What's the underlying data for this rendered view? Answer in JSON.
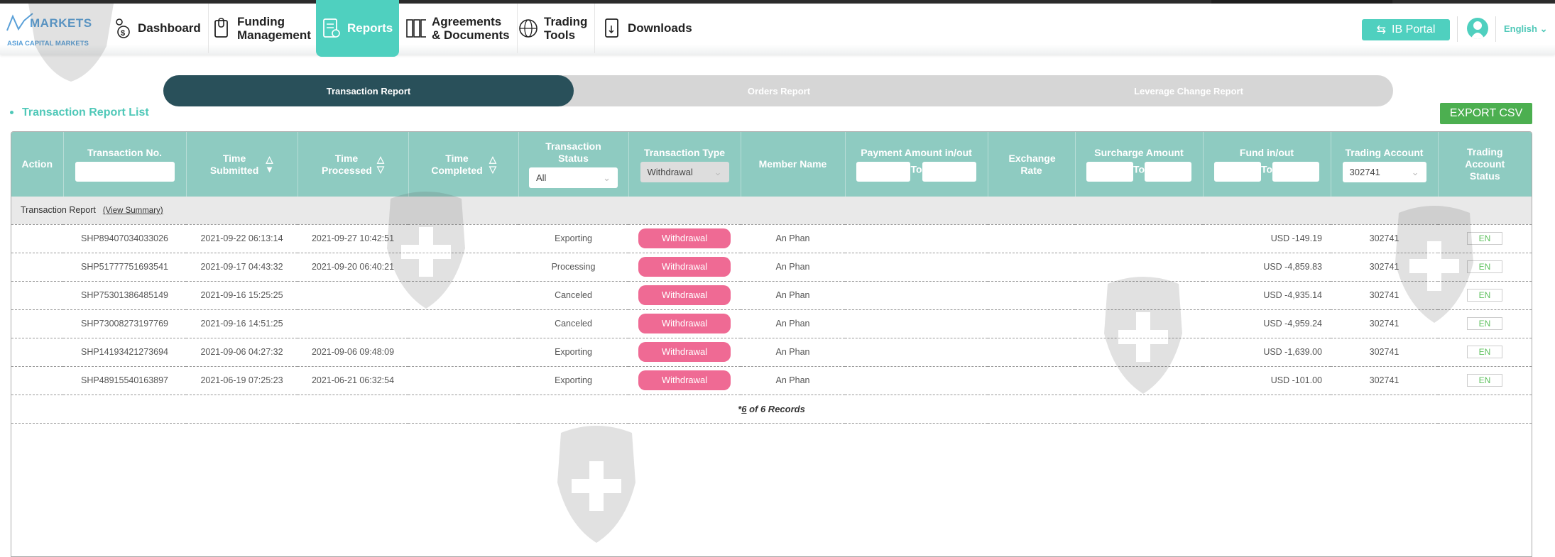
{
  "brand": {
    "logo_main": "MARKETS",
    "logo_sub": "ASIA CAPITAL MARKETS"
  },
  "nav": [
    {
      "label": "Dashboard"
    },
    {
      "label": "Funding\nManagement"
    },
    {
      "label": "Reports"
    },
    {
      "label": "Agreements\n& Documents"
    },
    {
      "label": "Trading\nTools"
    },
    {
      "label": "Downloads"
    }
  ],
  "header_right": {
    "ib_portal": "IB Portal",
    "language": "English"
  },
  "tabs": [
    "Transaction Report",
    "Orders Report",
    "Leverage Change Report"
  ],
  "page_title": "Transaction Report List",
  "export_label": "EXPORT CSV",
  "columns": {
    "action": "Action",
    "transaction_no": "Transaction No.",
    "time_submitted": "Time Submitted",
    "time_processed": "Time Processed",
    "time_completed": "Time Completed",
    "transaction_status": "Transaction Status",
    "transaction_type": "Transaction Type",
    "member_name": "Member Name",
    "payment_amount": "Payment Amount in/out",
    "exchange_rate": "Exchange Rate",
    "surcharge_amount": "Surcharge Amount",
    "fund_inout": "Fund in/out",
    "trading_account": "Trading Account",
    "trading_account_status": "Trading Account Status"
  },
  "filters": {
    "status": "All",
    "type": "Withdrawal",
    "trading_account": "302741",
    "to_label": "To"
  },
  "group": {
    "label": "Transaction Report",
    "link": "(View Summary)"
  },
  "rows": [
    {
      "no": "SHP89407034033026",
      "submitted": "2021-09-22 06:13:14",
      "processed": "2021-09-27 10:42:51",
      "completed": "",
      "status": "Exporting",
      "type": "Withdrawal",
      "member": "An Phan",
      "fund": "USD -149.19",
      "account": "302741",
      "acct_status": "EN"
    },
    {
      "no": "SHP51777751693541",
      "submitted": "2021-09-17 04:43:32",
      "processed": "2021-09-20 06:40:21",
      "completed": "",
      "status": "Processing",
      "type": "Withdrawal",
      "member": "An Phan",
      "fund": "USD -4,859.83",
      "account": "302741",
      "acct_status": "EN"
    },
    {
      "no": "SHP75301386485149",
      "submitted": "2021-09-16 15:25:25",
      "processed": "",
      "completed": "",
      "status": "Canceled",
      "type": "Withdrawal",
      "member": "An Phan",
      "fund": "USD -4,935.14",
      "account": "302741",
      "acct_status": "EN"
    },
    {
      "no": "SHP73008273197769",
      "submitted": "2021-09-16 14:51:25",
      "processed": "",
      "completed": "",
      "status": "Canceled",
      "type": "Withdrawal",
      "member": "An Phan",
      "fund": "USD -4,959.24",
      "account": "302741",
      "acct_status": "EN"
    },
    {
      "no": "SHP14193421273694",
      "submitted": "2021-09-06 04:27:32",
      "processed": "2021-09-06 09:48:09",
      "completed": "",
      "status": "Exporting",
      "type": "Withdrawal",
      "member": "An Phan",
      "fund": "USD -1,639.00",
      "account": "302741",
      "acct_status": "EN"
    },
    {
      "no": "SHP48915540163897",
      "submitted": "2021-06-19 07:25:23",
      "processed": "2021-06-21 06:32:54",
      "completed": "",
      "status": "Exporting",
      "type": "Withdrawal",
      "member": "An Phan",
      "fund": "USD -101.00",
      "account": "302741",
      "acct_status": "EN"
    }
  ],
  "records": {
    "prefix": "*",
    "count": "6",
    "suffix": " of 6 Records"
  },
  "colors": {
    "teal": "#4fd0bf",
    "header": "#8ecbc1",
    "dark_tab": "#29505a",
    "badge": "#ef6a94",
    "export": "#4caf50"
  }
}
